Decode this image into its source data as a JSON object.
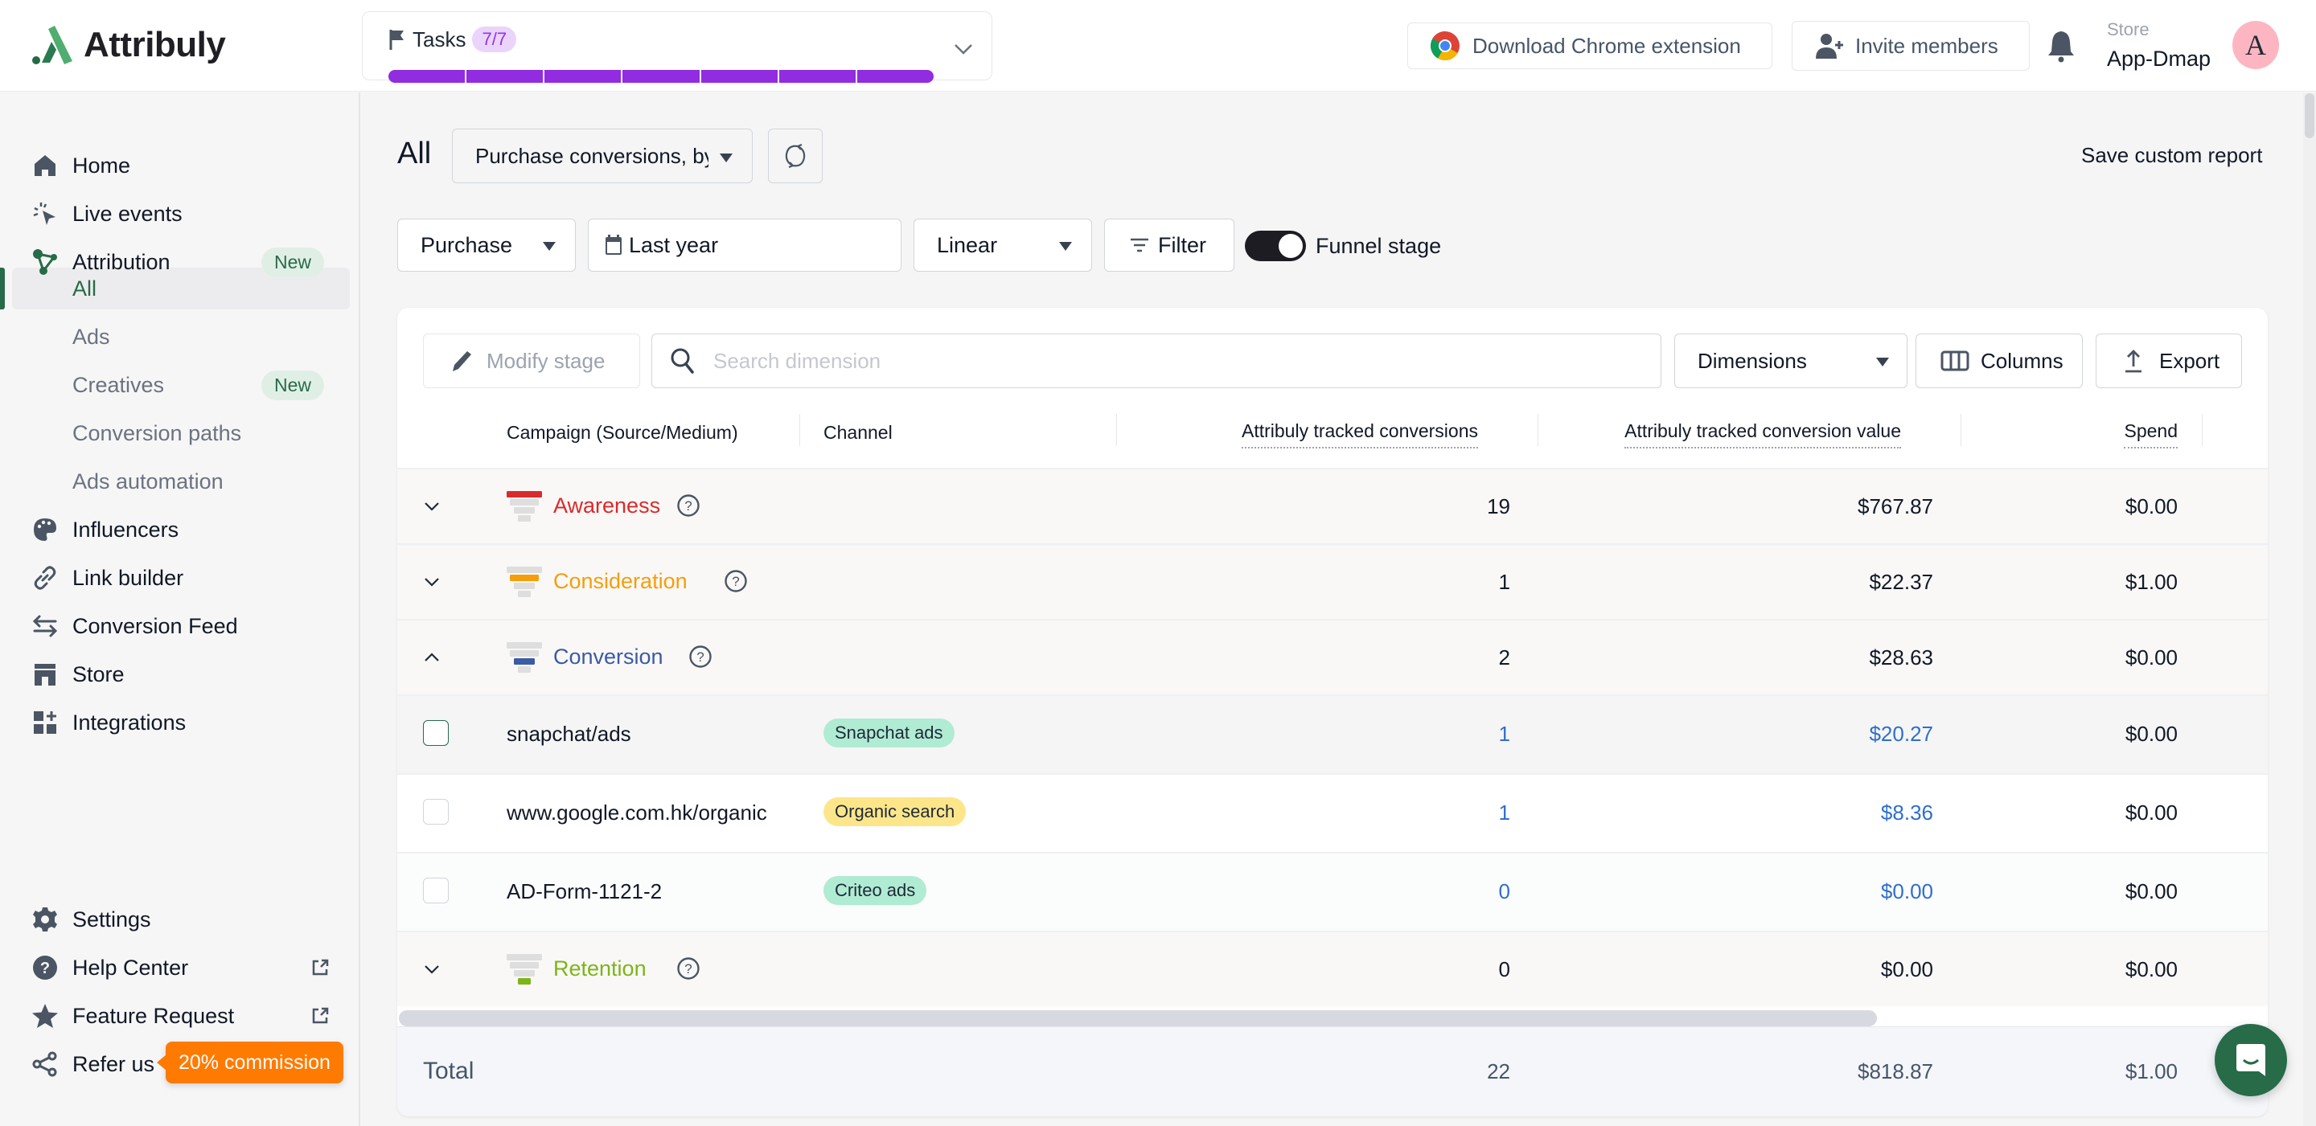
{
  "brand": {
    "name": "Attribuly"
  },
  "tasks": {
    "label": "Tasks",
    "badge": "7/7",
    "completed": 7,
    "total": 7,
    "bar_color": "#912ce0"
  },
  "header": {
    "chrome_extension_label": "Download Chrome extension",
    "invite_members_label": "Invite members",
    "store_label": "Store",
    "store_name": "App-Dmap",
    "avatar_letter": "A"
  },
  "sidebar": {
    "items": [
      {
        "label": "Home",
        "icon": "home-icon"
      },
      {
        "label": "Live events",
        "icon": "cursor-click-icon"
      },
      {
        "label": "Attribution",
        "icon": "attribution-nodes-icon",
        "badge": "New"
      },
      {
        "label": "All",
        "sub": true,
        "active": true
      },
      {
        "label": "Ads",
        "sub": true
      },
      {
        "label": "Creatives",
        "sub": true,
        "badge": "New"
      },
      {
        "label": "Conversion paths",
        "sub": true
      },
      {
        "label": "Ads automation",
        "sub": true
      },
      {
        "label": "Influencers",
        "icon": "palette-icon"
      },
      {
        "label": "Link builder",
        "icon": "link-icon"
      },
      {
        "label": "Conversion Feed",
        "icon": "arrows-exchange-icon"
      },
      {
        "label": "Store",
        "icon": "storefront-icon"
      },
      {
        "label": "Integrations",
        "icon": "integrations-icon"
      }
    ],
    "bottom": [
      {
        "label": "Settings",
        "icon": "gear-icon"
      },
      {
        "label": "Help Center",
        "icon": "help-circle-icon",
        "external": true
      },
      {
        "label": "Feature Request",
        "icon": "star-icon",
        "external": true
      },
      {
        "label": "Refer us",
        "icon": "share-icon"
      }
    ],
    "commission_label": "20% commission",
    "accent": "#276b48"
  },
  "main": {
    "title": "All",
    "report_select": "Purchase conversions, by",
    "save_custom_report": "Save custom report",
    "filters": {
      "event": "Purchase",
      "date_range": "Last year",
      "model": "Linear",
      "filter_label": "Filter",
      "funnel_stage_label": "Funnel stage",
      "funnel_stage_on": true
    },
    "toolbar": {
      "modify_stage": "Modify stage",
      "search_placeholder": "Search  dimension",
      "dimensions": "Dimensions",
      "columns": "Columns",
      "export": "Export"
    },
    "table": {
      "columns": [
        "Campaign (Source/Medium)",
        "Channel",
        "Attribuly tracked conversions",
        "Attribuly tracked conversion value",
        "Spend"
      ],
      "groups": [
        {
          "name": "Awareness",
          "color": "#d92b2b",
          "expanded": false,
          "conversions": "19",
          "value": "$767.87",
          "spend": "$0.00",
          "funnel_level": 0
        },
        {
          "name": "Consideration",
          "color": "#f59e0b",
          "expanded": false,
          "conversions": "1",
          "value": "$22.37",
          "spend": "$1.00",
          "funnel_level": 1
        },
        {
          "name": "Conversion",
          "color": "#3b5ba5",
          "expanded": true,
          "conversions": "2",
          "value": "$28.63",
          "spend": "$0.00",
          "funnel_level": 2,
          "rows": [
            {
              "campaign": "snapchat/ads",
              "channel": "Snapchat ads",
              "channel_color": "#b0ebd3",
              "conversions": "1",
              "value": "$20.27",
              "spend": "$0.00"
            },
            {
              "campaign": "www.google.com.hk/organic",
              "channel": "Organic search",
              "channel_color": "#fde68a",
              "conversions": "1",
              "value": "$8.36",
              "spend": "$0.00"
            },
            {
              "campaign": "AD-Form-1121-2",
              "channel": "Criteo ads",
              "channel_color": "#b0ebd3",
              "conversions": "0",
              "value": "$0.00",
              "spend": "$0.00"
            }
          ]
        },
        {
          "name": "Retention",
          "color": "#7cb518",
          "expanded": false,
          "conversions": "0",
          "value": "$0.00",
          "spend": "$0.00",
          "funnel_level": 3
        }
      ],
      "total": {
        "label": "Total",
        "conversions": "22",
        "value": "$818.87",
        "spend": "$1.00"
      },
      "link_color": "#2f6fcb"
    }
  }
}
